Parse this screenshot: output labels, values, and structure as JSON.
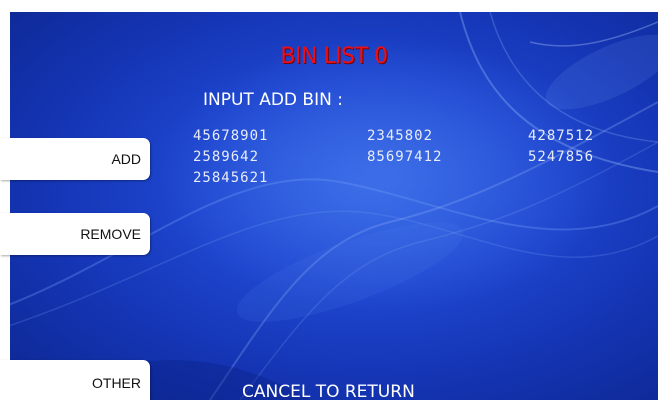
{
  "screen": {
    "title": "BIN LIST 0",
    "prompt": "INPUT ADD BIN :",
    "footer": "CANCEL TO RETURN"
  },
  "bins": [
    "45678901",
    "2345802",
    "4287512",
    "2589642",
    "85697412",
    "5247856",
    "25845621"
  ],
  "side_buttons": {
    "add": "ADD",
    "remove": "REMOVE",
    "other": "OTHER"
  },
  "colors": {
    "background": "#1e46cf",
    "title": "#e8101a",
    "text": "#ffffff",
    "button": "#ffffff"
  }
}
